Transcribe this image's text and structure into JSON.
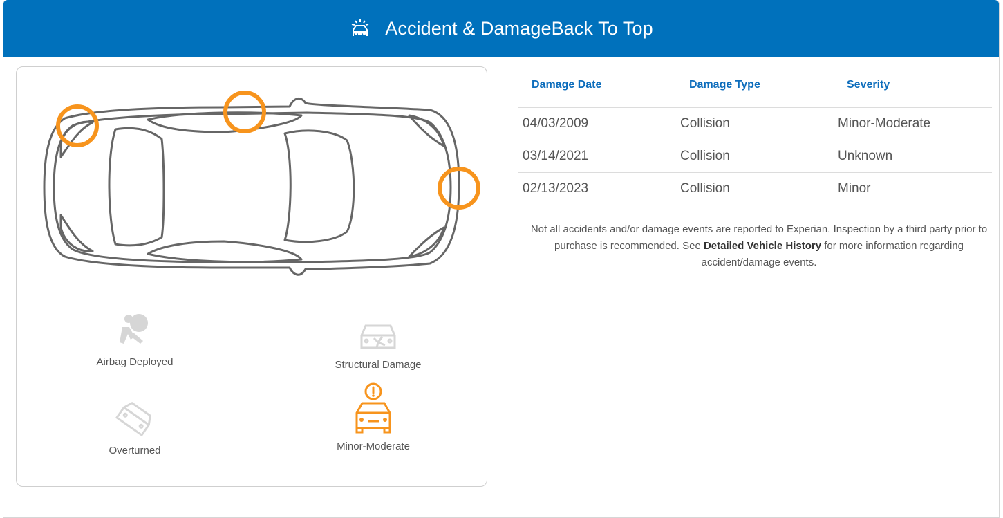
{
  "header": {
    "title": "Accident & Damage",
    "back_to_top": "Back To Top",
    "icon": "car-damage-icon"
  },
  "indicators": [
    {
      "label": "Airbag Deployed",
      "icon": "airbag-icon",
      "active": false
    },
    {
      "label": "Structural Damage",
      "icon": "structural-damage-icon",
      "active": false
    },
    {
      "label": "Overturned",
      "icon": "overturned-icon",
      "active": false
    },
    {
      "label": "Minor-Moderate",
      "icon": "car-alert-icon",
      "active": true
    }
  ],
  "table": {
    "headers": [
      "Damage Date",
      "Damage Type",
      "Severity"
    ],
    "rows": [
      [
        "04/03/2009",
        "Collision",
        "Minor-Moderate"
      ],
      [
        "03/14/2021",
        "Collision",
        "Unknown"
      ],
      [
        "02/13/2023",
        "Collision",
        "Minor"
      ]
    ]
  },
  "note": {
    "before": "Not all accidents and/or damage events are reported to Experian. Inspection by a third party prior to purchase is recommended. See ",
    "link": "Detailed Vehicle History",
    "after": " for more information regarding accident/damage events."
  },
  "colors": {
    "header_bg": "#0071bc",
    "header_text": "#ffffff",
    "accent": "#f7941d",
    "table_header": "#0d6dbc",
    "inactive_icon": "#d6d6d6"
  }
}
